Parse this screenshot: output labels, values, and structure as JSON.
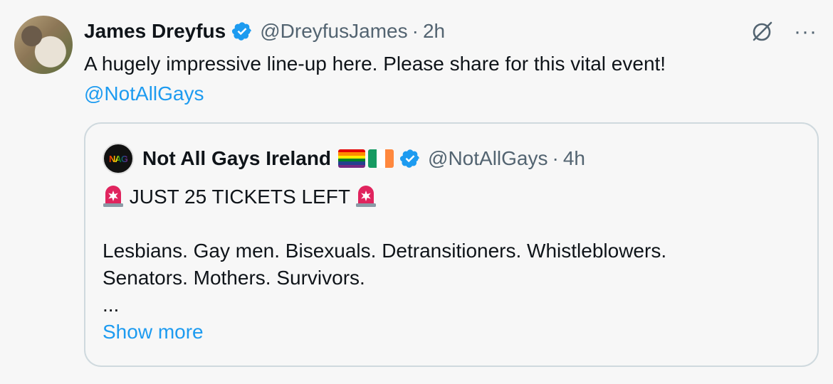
{
  "tweet": {
    "author_name": "James Dreyfus",
    "handle": "@DreyfusJames",
    "separator": "·",
    "time": "2h",
    "text": "A hugely impressive line-up here. Please share for this vital event!",
    "mention": "@NotAllGays",
    "more_label": "···",
    "colors": {
      "accent": "#1d9bf0",
      "muted": "#536471"
    }
  },
  "quote": {
    "author_name": "Not All Gays Ireland",
    "avatar_text": "NAG",
    "handle": "@NotAllGays",
    "separator": "·",
    "time": "4h",
    "headline": "JUST 25 TICKETS LEFT",
    "line1": "Lesbians. Gay men. Bisexuals. Detransitioners. Whistleblowers.",
    "line2": "Senators. Mothers. Survivors.",
    "ellipsis": "...",
    "show_more": "Show more",
    "emoji": [
      "rainbow-flag",
      "ireland-flag",
      "siren"
    ]
  }
}
